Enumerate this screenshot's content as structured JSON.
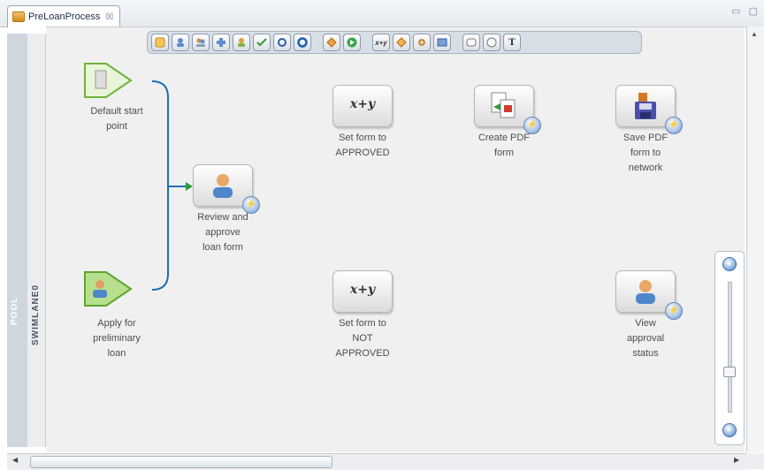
{
  "editor": {
    "tab_title": "PreLoanProcess",
    "tab_close": "☒",
    "window_controls": "▭ ▢"
  },
  "lanes": {
    "pool_label": "POOL",
    "swimlane_label": "SWIMLANE0"
  },
  "toolbar": {
    "tools": [
      "",
      "",
      "",
      "",
      "",
      "",
      "",
      "",
      "",
      "",
      "",
      "x+y",
      "",
      "",
      "",
      "",
      "",
      "T"
    ]
  },
  "nodes": {
    "default_start": {
      "label_line1": "Default start",
      "label_line2": "point"
    },
    "apply_loan": {
      "label_line1": "Apply for",
      "label_line2": "preliminary",
      "label_line3": "loan"
    },
    "review": {
      "label_line1": "Review and",
      "label_line2": "approve",
      "label_line3": "loan form"
    },
    "set_approved": {
      "icon_text": "x+y",
      "label_line1": "Set form to",
      "label_line2": "APPROVED"
    },
    "set_not_approved": {
      "icon_text": "x+y",
      "label_line1": "Set form to",
      "label_line2": "NOT",
      "label_line3": "APPROVED"
    },
    "create_pdf": {
      "label_line1": "Create PDF",
      "label_line2": "form"
    },
    "save_pdf": {
      "label_line1": "Save PDF",
      "label_line2": "form to",
      "label_line3": "network"
    },
    "view_status": {
      "label_line1": "View",
      "label_line2": "approval",
      "label_line3": "status"
    }
  },
  "zoom": {
    "plus": "+",
    "minus": "−",
    "level": 0.3
  },
  "colors": {
    "start_green": "#7bc242",
    "connector_blue": "#1f6fb2",
    "arrow_green": "#2e9a3a"
  }
}
